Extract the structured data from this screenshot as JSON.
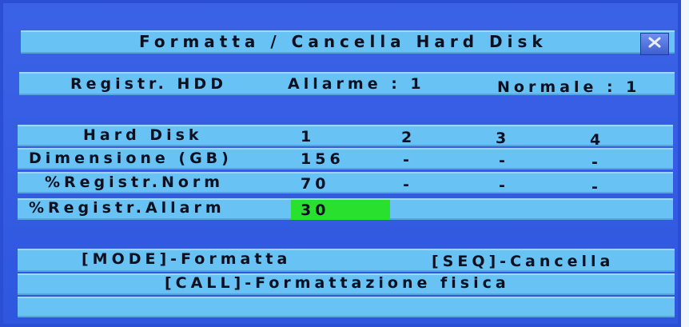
{
  "window": {
    "title": "Formatta / Cancella Hard Disk",
    "close_icon": "close-icon"
  },
  "record_hdd": {
    "label": "Registr. HDD",
    "alarm": "Allarme : 1",
    "normal": "Normale : 1"
  },
  "table": {
    "rows": [
      {
        "label": "Hard Disk",
        "cells": [
          "1",
          "2",
          "3",
          "4"
        ]
      },
      {
        "label": "Dimensione (GB)",
        "cells": [
          "156",
          "-",
          "-",
          "-"
        ]
      },
      {
        "label": "%Registr.Norm",
        "cells": [
          "70",
          "-",
          "-",
          "-"
        ]
      },
      {
        "label": "%Registr.Allarm",
        "cells": [
          "30",
          "",
          "",
          ""
        ]
      }
    ]
  },
  "actions": {
    "format": "[MODE]-Formatta",
    "delete": "[SEQ]-Cancella",
    "physical_format": "[CALL]-Formattazione fisica"
  },
  "colors": {
    "background": "#3b62e6",
    "bar": "#68c3f4",
    "highlight": "#29e02f"
  }
}
